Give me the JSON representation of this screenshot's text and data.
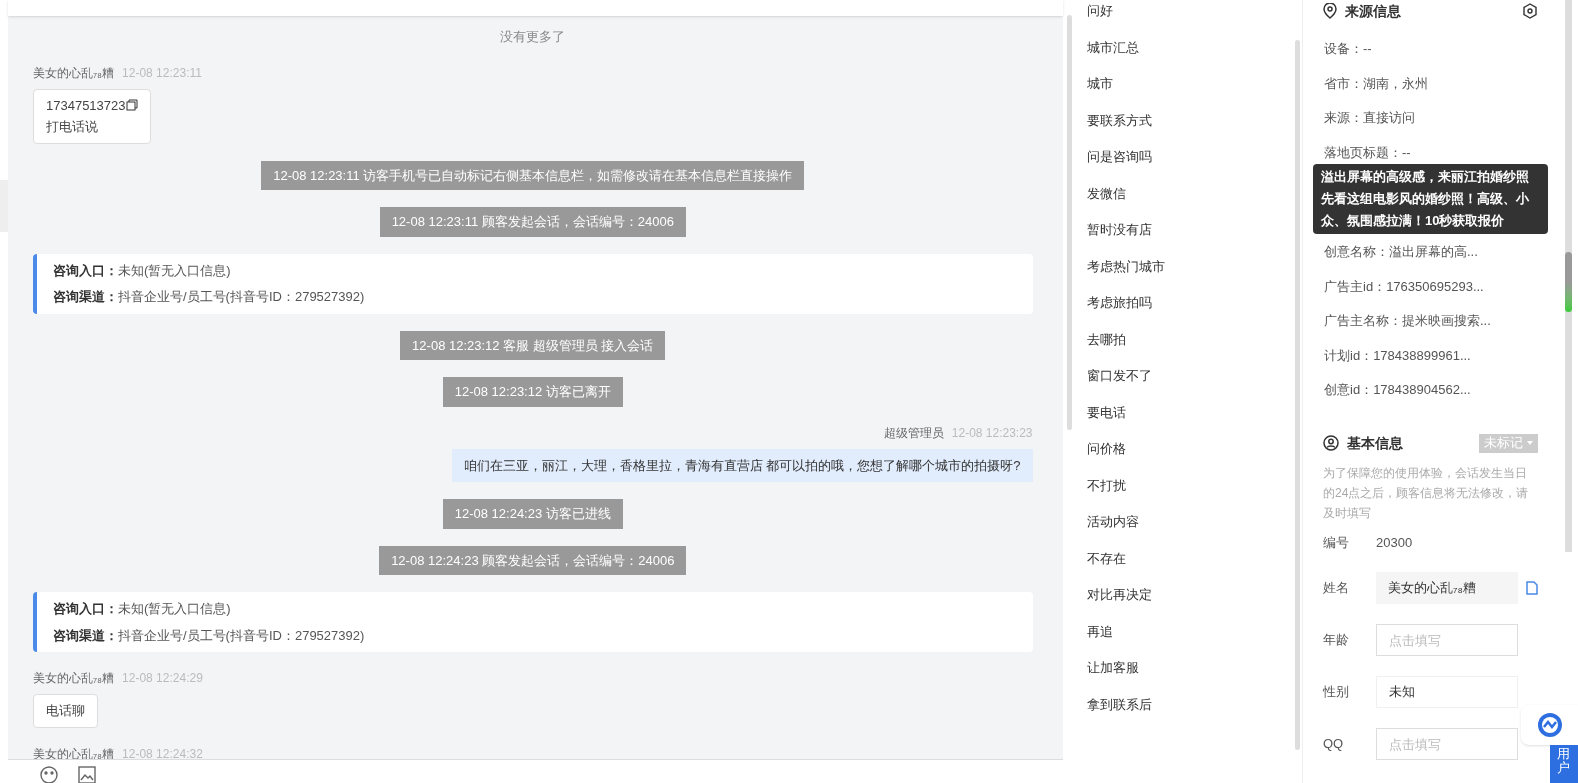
{
  "chat": {
    "no_more": "没有更多了",
    "messages": [
      {
        "kind": "visitor",
        "sender": "美女的心乱₇₈糟",
        "time": "12-08 12:23:11",
        "lines": [
          "17347513723",
          "打电话说"
        ],
        "copyable": true
      },
      {
        "kind": "system",
        "text": "12-08 12:23:11 访客手机号已自动标记右侧基本信息栏，如需修改请在基本信息栏直接操作"
      },
      {
        "kind": "system",
        "text": "12-08 12:23:11 顾客发起会话，会话编号：24006"
      },
      {
        "kind": "info",
        "rows": [
          {
            "label": "咨询入口：",
            "value": "未知(暂无入口信息)"
          },
          {
            "label": "咨询渠道：",
            "value": "抖音企业号/员工号(抖音号ID：279527392)"
          }
        ]
      },
      {
        "kind": "system",
        "text": "12-08 12:23:12 客服 超级管理员 接入会话"
      },
      {
        "kind": "system",
        "text": "12-08 12:23:12 访客已离开"
      },
      {
        "kind": "agent",
        "sender": "超级管理员",
        "time": "12-08 12:23:23",
        "lines": [
          "咱们在三亚，丽江，大理，香格里拉，青海有直营店 都可以拍的哦，您想了解哪个城市的拍摄呀?"
        ]
      },
      {
        "kind": "system",
        "text": "12-08 12:24:23 访客已进线"
      },
      {
        "kind": "system",
        "text": "12-08 12:24:23 顾客发起会话，会话编号：24006"
      },
      {
        "kind": "info",
        "rows": [
          {
            "label": "咨询入口：",
            "value": "未知(暂无入口信息)"
          },
          {
            "label": "咨询渠道：",
            "value": "抖音企业号/员工号(抖音号ID：279527392)"
          }
        ]
      },
      {
        "kind": "visitor",
        "sender": "美女的心乱₇₈糟",
        "time": "12-08 12:24:29",
        "lines": [
          "电话聊"
        ]
      },
      {
        "kind": "visitor",
        "sender": "美女的心乱₇₈糟",
        "time": "12-08 12:24:32"
      }
    ]
  },
  "quick_replies": [
    "问好",
    "城市汇总",
    "城市",
    "要联系方式",
    "问是咨询吗",
    "发微信",
    "暂时没有店",
    "考虑热门城市",
    "考虑旅拍吗",
    "去哪拍",
    "窗口发不了",
    "要电话",
    "问价格",
    "不打扰",
    "活动内容",
    "不存在",
    "对比再决定",
    "再追",
    "让加客服",
    "拿到联系后"
  ],
  "source_info": {
    "title": "来源信息",
    "rows": [
      {
        "label": "设备：",
        "value": "--"
      },
      {
        "label": "省市：",
        "value": "湖南，永州"
      },
      {
        "label": "来源：",
        "value": "直接访问"
      },
      {
        "label": "落地页标题：",
        "value": "--"
      }
    ],
    "tooltip": "溢出屏幕的高级感，来丽江拍婚纱照先看这组电影风的婚纱照！高级、小众、氛围感拉满！10秒获取报价",
    "rows_after": [
      {
        "label": "创意名称：",
        "value": "溢出屏幕的高..."
      },
      {
        "label": "广告主id：",
        "value": "176350695293..."
      },
      {
        "label": "广告主名称：",
        "value": "提米映画搜索..."
      },
      {
        "label": "计划id：",
        "value": "178438899961..."
      },
      {
        "label": "创意id：",
        "value": "178438904562..."
      }
    ]
  },
  "basic_info": {
    "title": "基本信息",
    "tag": "未标记",
    "notice": "为了保障您的使用体验，会话发生当日的24点之后，顾客信息将无法修改，请及时填写",
    "fields": [
      {
        "kind": "text",
        "label": "编号",
        "value": "20300"
      },
      {
        "kind": "filled",
        "label": "姓名",
        "value": "美女的心乱₇₈糟"
      },
      {
        "kind": "input",
        "label": "年龄",
        "placeholder": "点击填写"
      },
      {
        "kind": "select",
        "label": "性别",
        "value": "未知"
      },
      {
        "kind": "input",
        "label": "QQ",
        "placeholder": "点击填写"
      }
    ]
  },
  "side_tab": "用户"
}
